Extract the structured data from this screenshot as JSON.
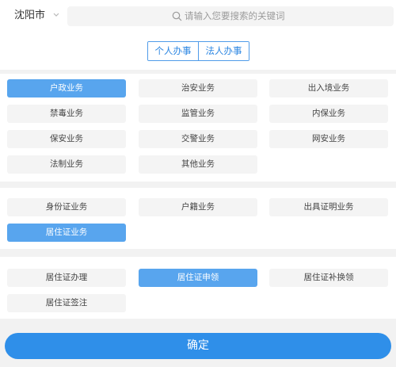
{
  "header": {
    "city": "沈阳市",
    "search_placeholder": "请输入您要搜索的关键词"
  },
  "segment": {
    "personal": "个人办事",
    "legal": "法人办事",
    "active": "个人办事"
  },
  "categories": [
    {
      "label": "户政业务",
      "active": true
    },
    {
      "label": "治安业务",
      "active": false
    },
    {
      "label": "出入境业务",
      "active": false
    },
    {
      "label": "禁毒业务",
      "active": false
    },
    {
      "label": "监管业务",
      "active": false
    },
    {
      "label": "内保业务",
      "active": false
    },
    {
      "label": "保安业务",
      "active": false
    },
    {
      "label": "交警业务",
      "active": false
    },
    {
      "label": "网安业务",
      "active": false
    },
    {
      "label": "法制业务",
      "active": false
    },
    {
      "label": "其他业务",
      "active": false
    }
  ],
  "subcategories": [
    {
      "label": "身份证业务",
      "active": false
    },
    {
      "label": "户籍业务",
      "active": false
    },
    {
      "label": "出具证明业务",
      "active": false
    },
    {
      "label": "居住证业务",
      "active": true
    }
  ],
  "items": [
    {
      "label": "居住证办理",
      "active": false
    },
    {
      "label": "居住证申领",
      "active": true
    },
    {
      "label": "居住证补换领",
      "active": false
    },
    {
      "label": "居住证签注",
      "active": false
    }
  ],
  "confirm_label": "确定",
  "colors": {
    "accent": "#2f8fe9",
    "active_tile": "#58a5ee",
    "tile_bg": "#f4f4f4",
    "page_bg": "#f2f2f2"
  },
  "icons": {
    "city_dropdown": "chevron-down-icon",
    "search": "search-icon"
  }
}
